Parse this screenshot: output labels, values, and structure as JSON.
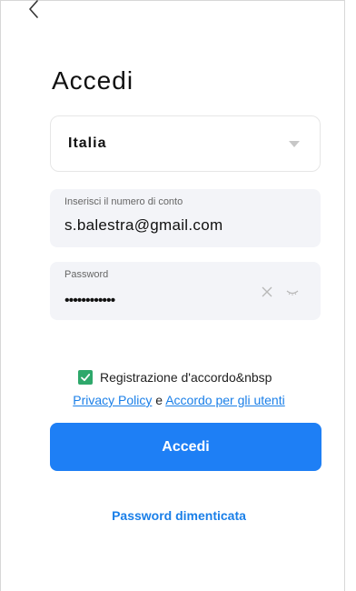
{
  "screen": {
    "title": "Accedi"
  },
  "country": {
    "selected": "Italia"
  },
  "account": {
    "label": "Inserisci il numero di conto",
    "value": "s.balestra@gmail.com"
  },
  "password": {
    "label": "Password",
    "masked_value": "••••••••••••"
  },
  "agreement": {
    "checked": true,
    "text": "Registrazione d'accordo&nbsp",
    "privacy_label": "Privacy Policy",
    "conjunction": "e",
    "terms_label": "Accordo per gli utenti"
  },
  "actions": {
    "login_label": "Accedi",
    "forgot_label": "Password dimenticata"
  },
  "colors": {
    "accent": "#1e7ff5",
    "link": "#1a7fe8",
    "checkbox": "#2ea86b",
    "field_background": "#f3f4f8"
  },
  "icons": {
    "back": "chevron-left-icon",
    "dropdown": "caret-down-icon",
    "clear": "close-icon",
    "visibility": "eye-closed-icon",
    "check": "checkmark-icon"
  }
}
